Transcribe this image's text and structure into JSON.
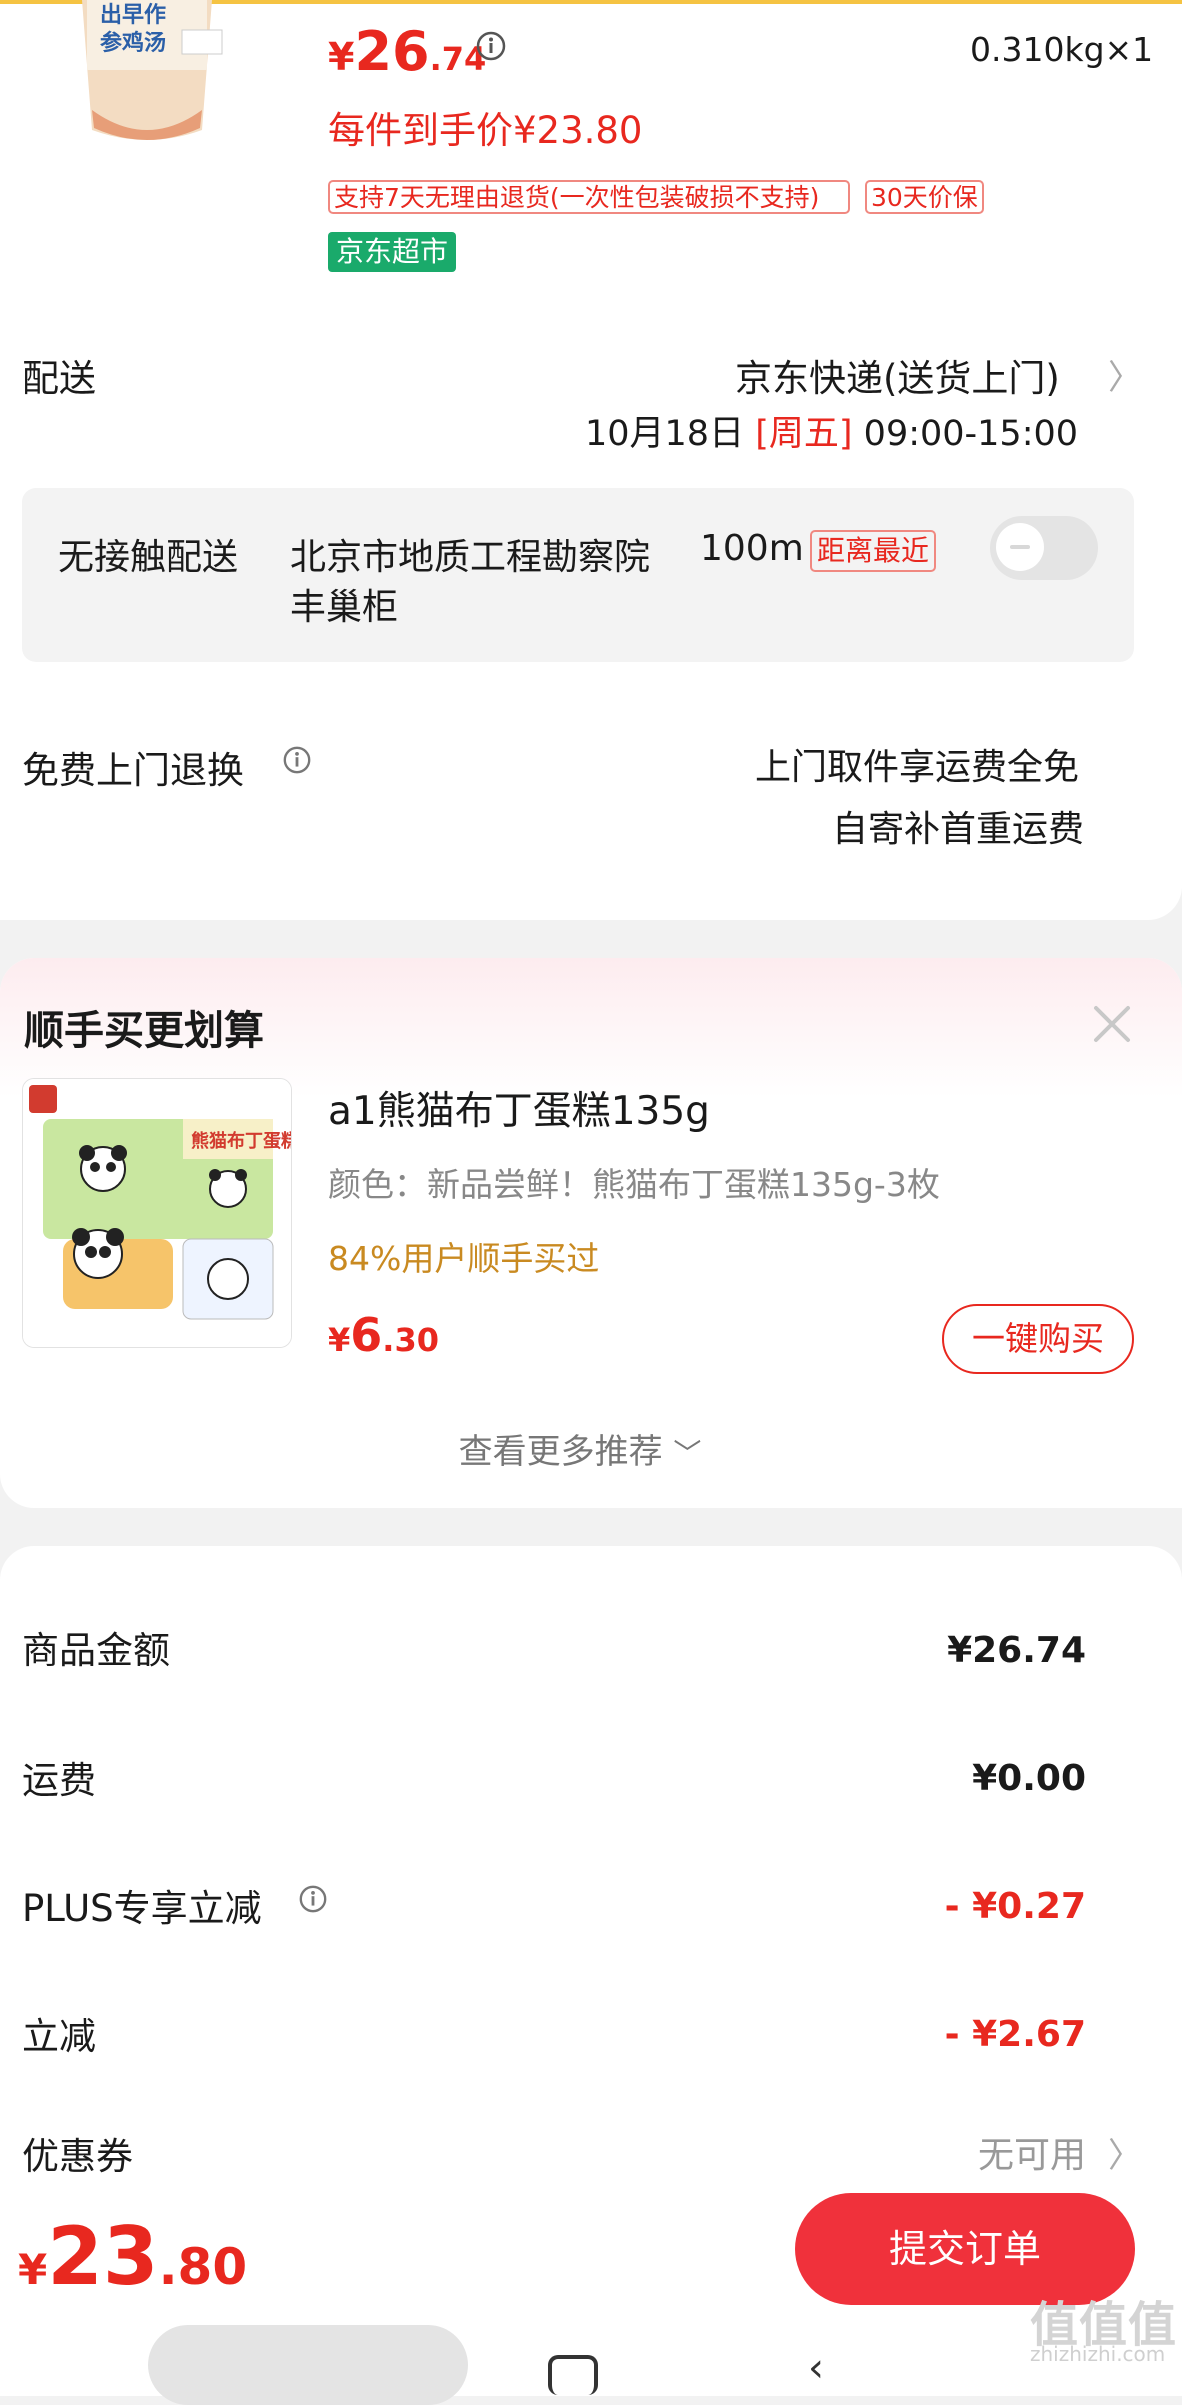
{
  "product": {
    "thumb_text": "出早作参鸡汤",
    "price_currency": "¥",
    "price_int": "26",
    "price_dec": ".74",
    "quantity": "0.310kg×1",
    "hand_price": "每件到手价¥23.80",
    "tags": [
      "支持7天无理由退货(一次性包装破损不支持)",
      "30天价保"
    ],
    "store_badge": "京东超市"
  },
  "shipping": {
    "label": "配送",
    "method": "京东快递(送货上门)",
    "date": "10月18日",
    "weekday": "[周五]",
    "time": "09:00-15:00",
    "contactless_label": "无接触配送",
    "locker_address": "北京市地质工程勘察院",
    "locker_distance": "100m",
    "nearest_badge": "距离最近",
    "locker_name": "丰巢柜",
    "contactless_enabled": false
  },
  "returns": {
    "label": "免费上门退换",
    "line1": "上门取件享运费全免",
    "line2": "自寄补首重运费"
  },
  "recommend": {
    "title": "顺手买更划算",
    "image_text": "熊猫布丁蛋糕",
    "name": "a1熊猫布丁蛋糕135g",
    "spec": "颜色：新品尝鲜！熊猫布丁蛋糕135g-3枚",
    "bought": "84%用户顺手买过",
    "price_currency": "¥",
    "price_int": "6",
    "price_dec": ".30",
    "buy_button": "一键购买",
    "more_link": "查看更多推荐"
  },
  "summary": {
    "goods_label": "商品金额",
    "goods_value": "¥26.74",
    "shipping_label": "运费",
    "shipping_value": "¥0.00",
    "plus_label": "PLUS专享立减",
    "plus_value": "- ¥0.27",
    "discount_label": "立减",
    "discount_value": "- ¥2.67",
    "coupon_label": "优惠券",
    "coupon_value": "无可用"
  },
  "bottom": {
    "total_currency": "¥",
    "total_int": "23",
    "total_dec": ".80",
    "submit_label": "提交订单"
  },
  "watermark": {
    "logo": "值值值",
    "site": "zhizhizhi.com"
  },
  "colors": {
    "accent_red": "#e8281f",
    "submit_red": "#f0313b",
    "store_green": "#1aaa6b",
    "bought_orange": "#c98a21"
  }
}
